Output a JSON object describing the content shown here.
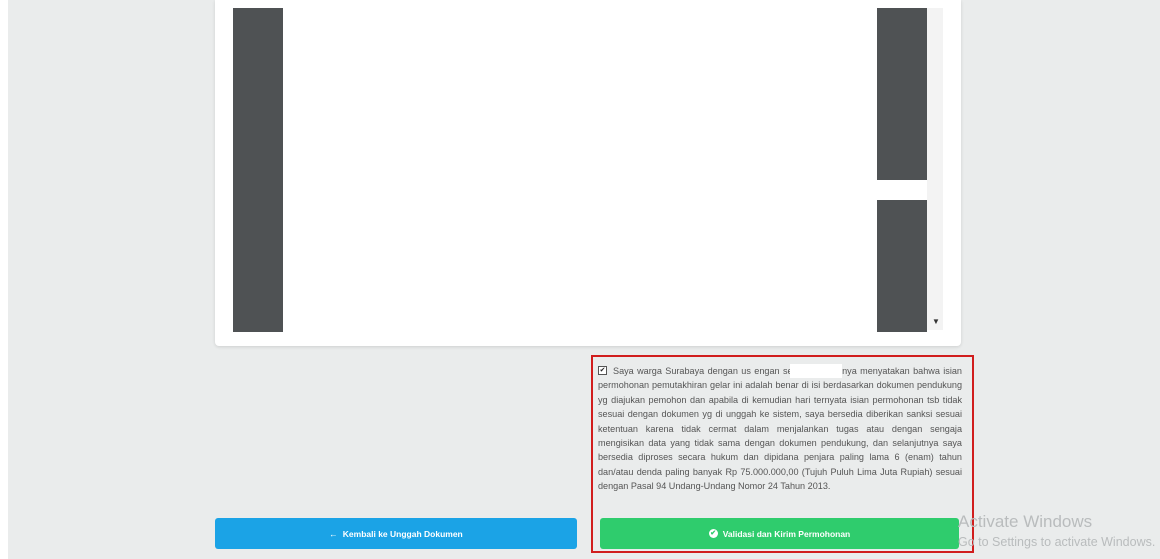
{
  "consent": {
    "checkbox_mark": "✔",
    "text": "Saya warga Surabaya dengan us                engan sebenar-benarnya menyatakan bahwa isian permohonan pemutakhiran gelar ini adalah benar di isi berdasarkan dokumen pendukung yg diajukan pemohon dan apabila di kemudian hari ternyata isian permohonan tsb tidak sesuai dengan dokumen yg di unggah ke sistem, saya bersedia diberikan sanksi sesuai ketentuan karena tidak cermat dalam menjalankan tugas atau dengan sengaja mengisikan data yang tidak sama dengan dokumen pendukung, dan selanjutnya saya bersedia diproses secara hukum dan dipidana penjara paling lama 6 (enam) tahun dan/atau denda paling banyak Rp 75.000.000,00 (Tujuh Puluh Lima Juta Rupiah) sesuai dengan Pasal 94 Undang-Undang Nomor 24 Tahun 2013."
  },
  "buttons": {
    "back_icon": "←",
    "back_label": "Kembali ke Unggah Dokumen",
    "submit_icon": "✔",
    "submit_label": "Validasi dan Kirim Permohonan"
  },
  "watermark": {
    "line1": "Activate Windows",
    "line2": "Go to Settings to activate Windows."
  },
  "viewer": {
    "scroll_arrow": "▼"
  }
}
